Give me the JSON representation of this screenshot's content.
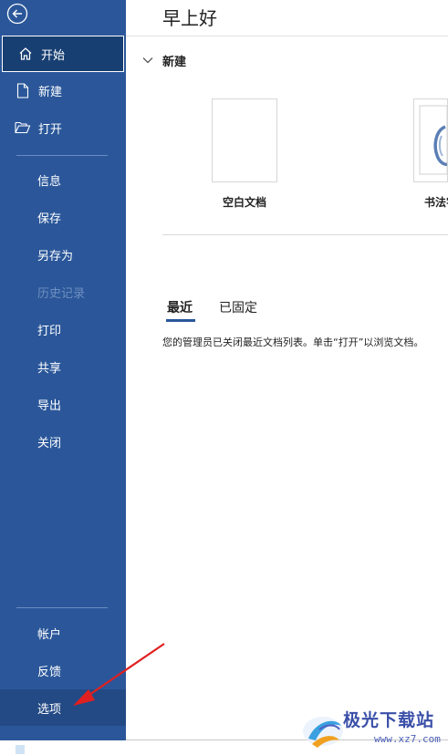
{
  "sidebar": {
    "items": [
      {
        "label": "开始",
        "icon": "home-icon"
      },
      {
        "label": "新建",
        "icon": "document-icon"
      },
      {
        "label": "打开",
        "icon": "folder-open-icon"
      },
      {
        "label": "信息"
      },
      {
        "label": "保存"
      },
      {
        "label": "另存为"
      },
      {
        "label": "历史记录"
      },
      {
        "label": "打印"
      },
      {
        "label": "共享"
      },
      {
        "label": "导出"
      },
      {
        "label": "关闭"
      },
      {
        "label": "帐户"
      },
      {
        "label": "反馈"
      },
      {
        "label": "选项"
      }
    ],
    "selected": "开始",
    "disabled": "历史记录",
    "colors": {
      "background": "#2b579a",
      "selected": "#183f72"
    }
  },
  "main": {
    "greeting": "早上好",
    "new_section_title": "新建",
    "templates": [
      {
        "name": "空白文档"
      },
      {
        "name": "书法字"
      }
    ],
    "tabs": [
      {
        "label": "最近"
      },
      {
        "label": "已固定"
      }
    ],
    "active_tab": "最近",
    "recent_message": "您的管理员已关闭最近文档列表。单击“打开”以浏览文档。"
  },
  "watermark": {
    "brand": "极光下载站",
    "url": "www.xz7.com"
  },
  "annotation": {
    "color": "#e02020"
  }
}
